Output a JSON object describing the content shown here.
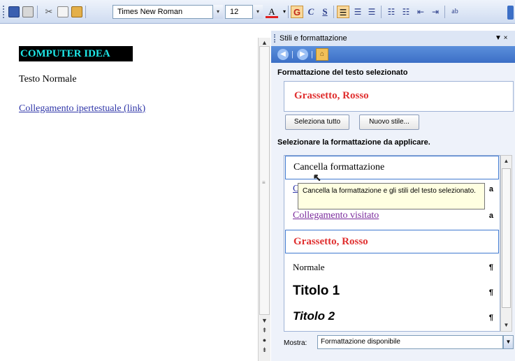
{
  "toolbar": {
    "font_name": "Times New Roman",
    "font_size": "12",
    "bold_glyph": "G",
    "italic_glyph": "C",
    "underline_glyph": "S",
    "font_color_glyph": "A",
    "dropdown_arrow": "▾"
  },
  "document": {
    "heading": "COMPUTER IDEA",
    "normal_text": "Testo Normale",
    "link_text": "Collegamento ipertestuale (link)"
  },
  "pane": {
    "title": "Stili e formattazione",
    "close_glyph": "▼ ×",
    "selected_section_label": "Formattazione del testo selezionato",
    "selected_format": "Grassetto, Rosso",
    "select_all_button": "Seleziona tutto",
    "new_style_button": "Nuovo stile...",
    "apply_section_label": "Selezionare la formattazione da applicare.",
    "styles": [
      {
        "label": "Cancella formattazione",
        "mark": ""
      },
      {
        "label": "Co",
        "mark": "a"
      },
      {
        "label": "Collegamento visitato",
        "mark": "a"
      },
      {
        "label": "Grassetto, Rosso",
        "mark": ""
      },
      {
        "label": "Normale",
        "mark": "¶"
      },
      {
        "label": "Titolo 1",
        "mark": "¶"
      },
      {
        "label": "Titolo 2",
        "mark": "¶"
      }
    ],
    "tooltip": "Cancella la formattazione e gli stili del testo selezionato.",
    "show_label": "Mostra:",
    "show_value": "Formattazione disponibile"
  },
  "colors": {
    "heading_text": "#1ee7e7",
    "heading_bg": "#000000",
    "link": "#2f36a8",
    "visited_link": "#7a2a9c",
    "bold_red": "#e03030",
    "pane_header": "#3c6fc6"
  }
}
